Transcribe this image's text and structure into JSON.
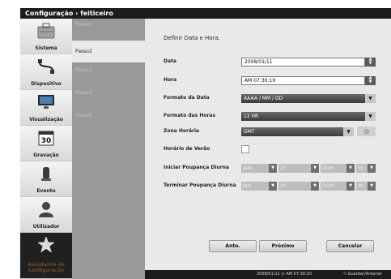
{
  "title": "Configuração › feiticeiro",
  "nav": [
    {
      "label": "Sistema",
      "icon": "toolbox-icon"
    },
    {
      "label": "Dispositivo",
      "icon": "cable-icon"
    },
    {
      "label": "Visualização",
      "icon": "monitor-icon"
    },
    {
      "label": "Gravação",
      "icon": "calendar-30-icon"
    },
    {
      "label": "Evento",
      "icon": "alarm-icon"
    },
    {
      "label": "Utilizador",
      "icon": "user-icon"
    },
    {
      "label": "Assistente de Configuração",
      "icon": "wizard-icon"
    }
  ],
  "steps": [
    "Passo1",
    "Passo2",
    "Passo3",
    "Passo4",
    "Passo5"
  ],
  "active_step": 1,
  "form": {
    "heading": "Definir Data e Hora.",
    "date_label": "Data",
    "date_value": "2008/01/11",
    "time_label": "Hora",
    "time_value": "AM 07:30:19",
    "date_format_label": "Formato da Data",
    "date_format_value": "AAAA / MM / DD",
    "time_format_label": "Formato das Horas",
    "time_format_value": "12 HR",
    "timezone_label": "Zona Horária",
    "timezone_value": "GMT",
    "dst_label": "Horário de Verão",
    "dst_start_label": "Iniciar Poupança Diurna",
    "dst_end_label": "Terminar Poupança Diurna",
    "dst_start": [
      "JAN",
      "1ª",
      "DOM",
      "00"
    ],
    "dst_end": [
      "JAN",
      "1ª",
      "DOM",
      "00"
    ]
  },
  "buttons": {
    "prev": "Ante.",
    "next": "Próximo",
    "cancel": "Cancelar"
  },
  "status": {
    "clock": "2008/01/11 ◷ AM 07:30:20",
    "save": "Guardar/Anterior"
  }
}
